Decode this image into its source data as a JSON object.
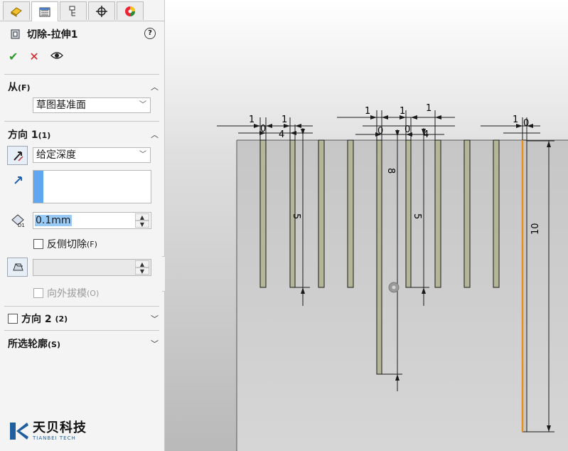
{
  "feature": {
    "title": "切除-拉伸1"
  },
  "tabs": [
    "feature-manager-icon",
    "property-manager-icon",
    "configuration-manager-icon",
    "dimxpert-icon",
    "display-manager-icon"
  ],
  "from": {
    "title": "从",
    "shortcut": "(F)",
    "value": "草图基准面"
  },
  "direction1": {
    "title": "方向 1",
    "shortcut": "(1)",
    "end_condition": "给定深度",
    "depth": "0.1mm",
    "flip_label": "反侧切除",
    "flip_shortcut": "(F)",
    "draft_label": "向外拔模",
    "draft_shortcut": "(O)"
  },
  "direction2": {
    "title": "方向 2",
    "shortcut": "(2)"
  },
  "contours": {
    "title": "所选轮廓",
    "shortcut": "(S)"
  },
  "logo": {
    "cn": "天贝科技",
    "en": "TIANBEI TECH"
  },
  "dims": {
    "a1": "1",
    "a2": "1",
    "a3": "0",
    "a4": "4",
    "b1": "1",
    "b2": "1",
    "b3": "1",
    "b4": "0",
    "b5": "0",
    "b6": "4",
    "c1": "1",
    "c2": "0",
    "h1": "5",
    "h2": "8",
    "h3": "5",
    "h4": "10"
  },
  "colors": {
    "slot": "#b5b597",
    "selected_edge": "#e8901a",
    "accent": "#5fa7f0"
  }
}
